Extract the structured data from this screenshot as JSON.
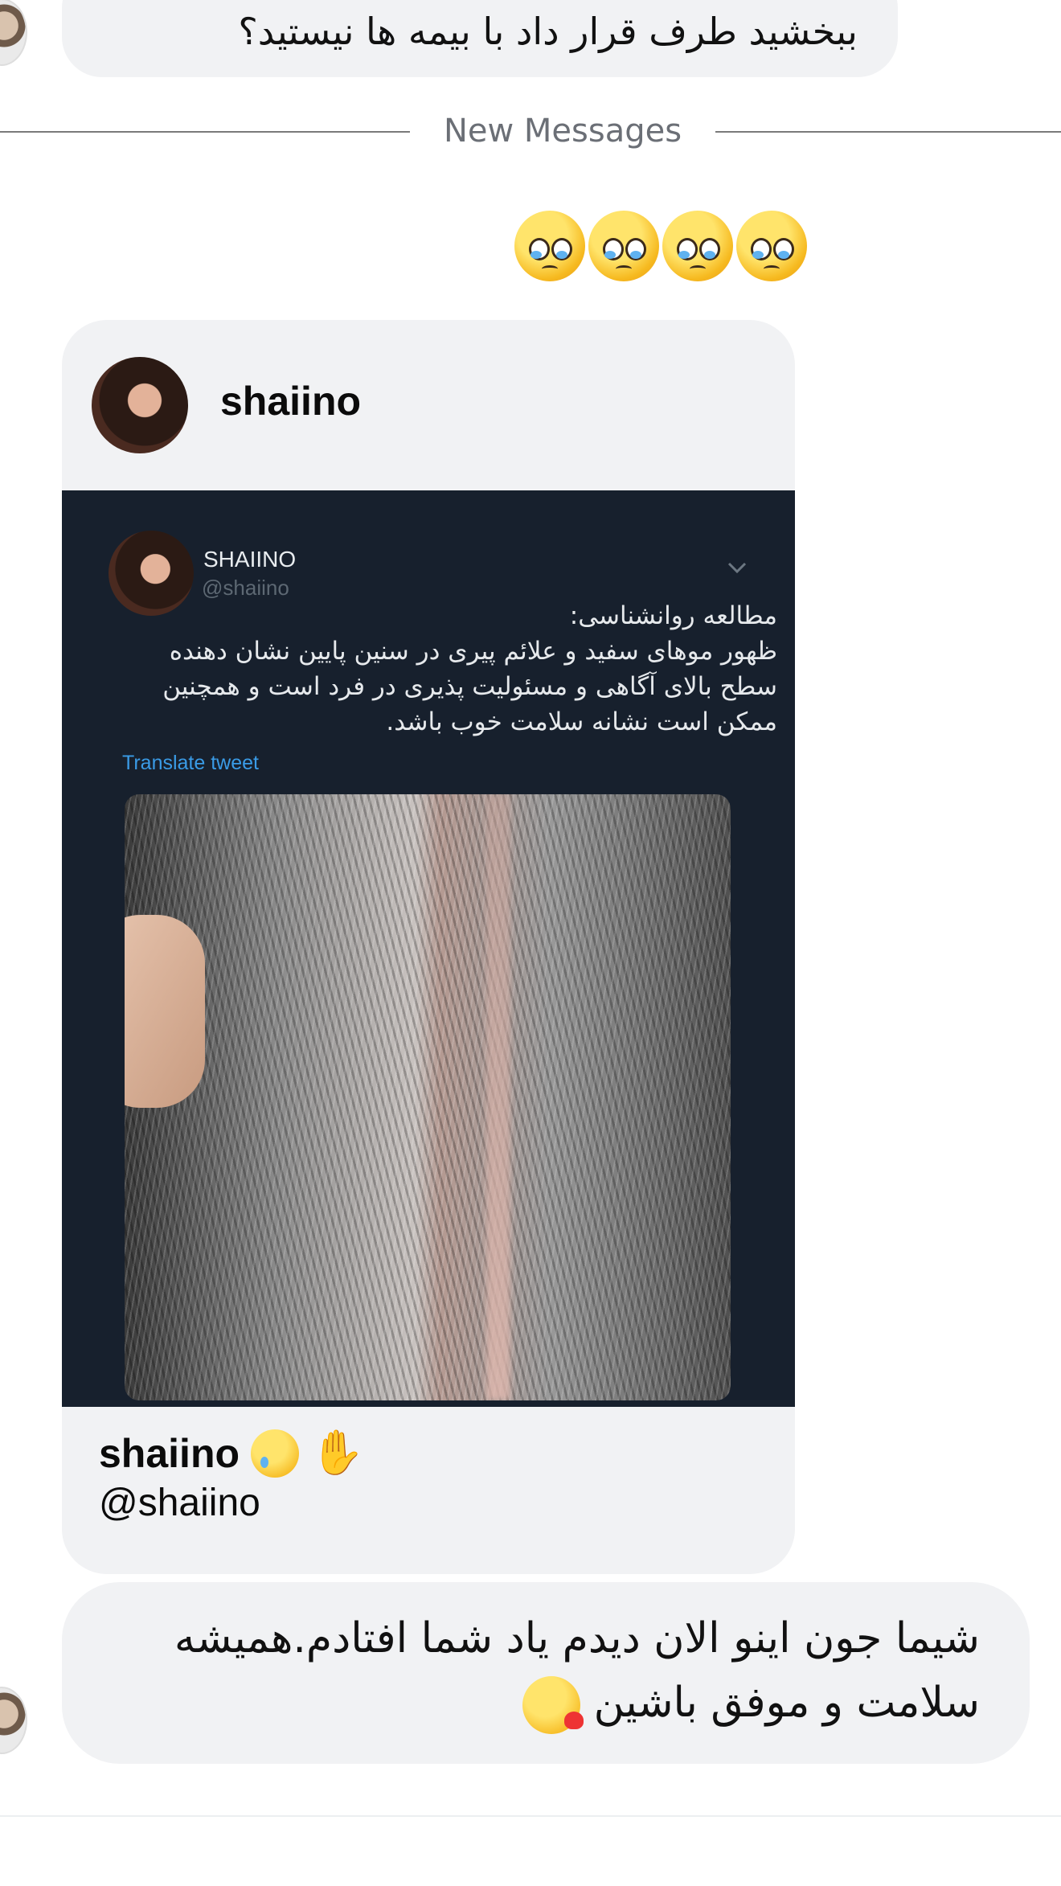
{
  "messages": {
    "top": {
      "text": "ببخشید طرف قرار داد با بیمه ها نیستید؟"
    },
    "divider": {
      "label": "New Messages"
    },
    "emoji_reaction": {
      "icon": "pleading-face-icon",
      "count": 4
    },
    "shared_post": {
      "author_name": "shaiino",
      "tweet": {
        "display_name": "SHAIINO",
        "handle": "@shaiino",
        "text_line1": "مطالعه روانشناسی:",
        "text_line2": "ظهور موهای سفید و علائم پیری در سنین پایین نشان دهنده",
        "text_line3": "سطح بالای آگاهی و مسئولیت پذیری در فرد است و همچنین",
        "text_line4": "ممکن است نشانه سلامت خوب باشد.",
        "translate_label": "Translate tweet",
        "image": "gray-hair-photo"
      },
      "footer_name": "shaiino",
      "footer_handle": "@shaiino",
      "footer_emojis": [
        "face-holding-back-tears-icon",
        "pinching-hand-icon"
      ]
    },
    "bottom": {
      "text_line1": "شیما جون اینو الان دیدم یاد شما افتادم.همیشه",
      "text_line2": "سلامت و موفق باشین",
      "emoji": "face-blowing-kiss-icon"
    }
  },
  "colors": {
    "bubble": "#f1f2f4",
    "tweet_bg": "#17202d",
    "link": "#3a9be6"
  }
}
